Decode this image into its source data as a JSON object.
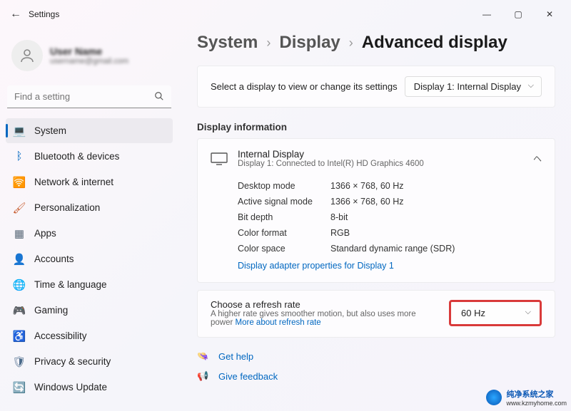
{
  "window": {
    "title": "Settings"
  },
  "profile": {
    "name": "User Name",
    "email": "username@gmail.com"
  },
  "search": {
    "placeholder": "Find a setting"
  },
  "sidebar": {
    "items": [
      {
        "label": "System",
        "icon": "💻",
        "color": "#0067c0",
        "selected": true
      },
      {
        "label": "Bluetooth & devices",
        "icon": "ᛒ",
        "color": "#0067c0"
      },
      {
        "label": "Network & internet",
        "icon": "🛜",
        "color": "#1da1d8"
      },
      {
        "label": "Personalization",
        "icon": "🖌",
        "color": "#c85c2e"
      },
      {
        "label": "Apps",
        "icon": "▦",
        "color": "#5c6b7a"
      },
      {
        "label": "Accounts",
        "icon": "👤",
        "color": "#5a7a3a"
      },
      {
        "label": "Time & language",
        "icon": "🌐",
        "color": "#4a6a8a"
      },
      {
        "label": "Gaming",
        "icon": "🎮",
        "color": "#6a7a8a"
      },
      {
        "label": "Accessibility",
        "icon": "♿",
        "color": "#3a5a9a"
      },
      {
        "label": "Privacy & security",
        "icon": "🛡",
        "color": "#4a6a8a"
      },
      {
        "label": "Windows Update",
        "icon": "🔄",
        "color": "#1a8ad8"
      }
    ]
  },
  "breadcrumb": {
    "a": "System",
    "b": "Display",
    "c": "Advanced display"
  },
  "selector": {
    "text": "Select a display to view or change its settings",
    "value": "Display 1: Internal Display"
  },
  "section": {
    "title": "Display information"
  },
  "info": {
    "title": "Internal Display",
    "subtitle": "Display 1: Connected to Intel(R) HD Graphics 4600",
    "rows": [
      {
        "k": "Desktop mode",
        "v": "1366 × 768, 60 Hz"
      },
      {
        "k": "Active signal mode",
        "v": "1366 × 768, 60 Hz"
      },
      {
        "k": "Bit depth",
        "v": "8-bit"
      },
      {
        "k": "Color format",
        "v": "RGB"
      },
      {
        "k": "Color space",
        "v": "Standard dynamic range (SDR)"
      }
    ],
    "adapter_link": "Display adapter properties for Display 1"
  },
  "refresh": {
    "title": "Choose a refresh rate",
    "subtitle_a": "A higher rate gives smoother motion, but also uses more power ",
    "more": "More about refresh rate",
    "value": "60 Hz"
  },
  "footer": {
    "help": "Get help",
    "feedback": "Give feedback"
  },
  "watermark": {
    "line1": "纯净系统之家",
    "line2": "www.kzmyhome.com"
  }
}
